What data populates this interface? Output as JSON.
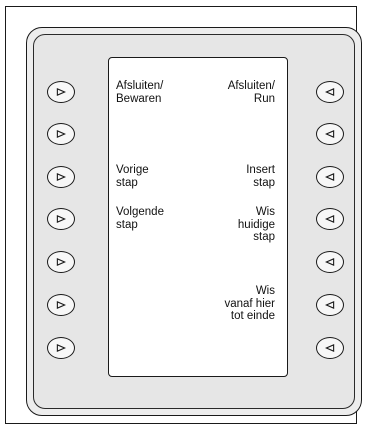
{
  "panel": {
    "left_labels": [
      [
        "Afsluiten/",
        "Bewaren"
      ],
      [],
      [
        "Vorige",
        "stap"
      ],
      [
        "Volgende",
        "stap"
      ],
      [],
      [],
      []
    ],
    "right_labels": [
      [
        "Afsluiten/",
        "Run"
      ],
      [],
      [
        "Insert",
        "stap"
      ],
      [
        "Wis",
        "huidige",
        "stap"
      ],
      [],
      [
        "Wis",
        "vanaf hier",
        "tot einde"
      ],
      []
    ],
    "left_key_icon": "triangle-right-icon",
    "right_key_icon": "triangle-left-icon"
  }
}
